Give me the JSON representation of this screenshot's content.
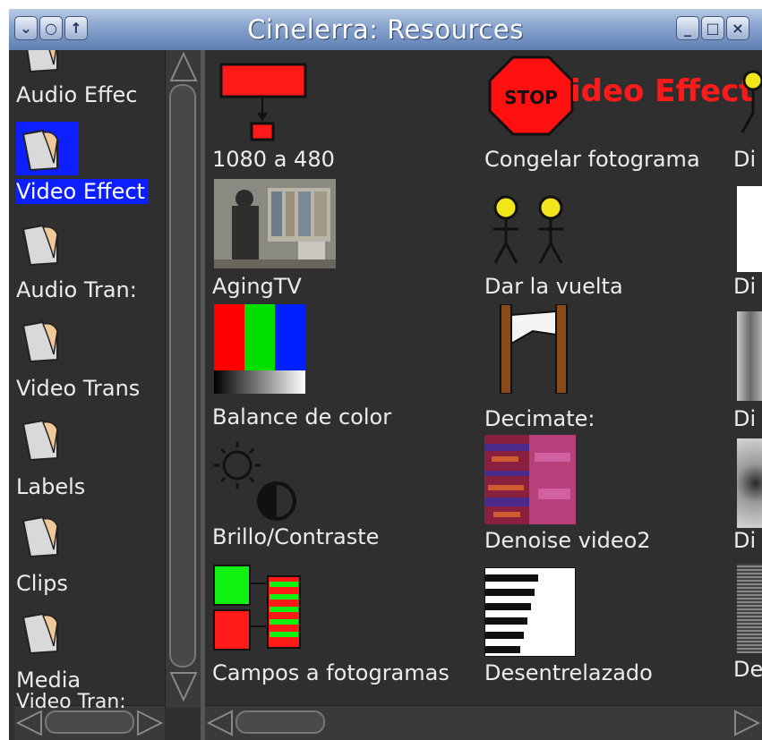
{
  "window": {
    "title": "Cinelerra: Resources",
    "left_buttons": [
      "menu-icon",
      "circle-icon",
      "up-arrow-icon"
    ],
    "right_buttons": [
      "minimize-icon",
      "maximize-icon",
      "close-icon"
    ],
    "right_button_glyphs": [
      "_",
      "□",
      "×"
    ],
    "left_button_glyphs": [
      "⌄",
      "○",
      "↑"
    ]
  },
  "folders": [
    {
      "label": "Audio Effec",
      "selected": false
    },
    {
      "label": "Video Effect",
      "selected": true
    },
    {
      "label": "Audio Tran:",
      "selected": false
    },
    {
      "label": "Video Trans",
      "selected": false
    },
    {
      "label": "Labels",
      "selected": false
    },
    {
      "label": "Clips",
      "selected": false
    },
    {
      "label": "Media",
      "selected": false
    }
  ],
  "bottom_partial_label": "Video Tran:",
  "resources": {
    "col1": [
      "1080 a 480",
      "AgingTV",
      "Balance de color",
      "Brillo/Contraste",
      "Campos a fotogramas"
    ],
    "col2": [
      "Congelar fotograma",
      "Dar la vuelta",
      "Decimate:",
      "Denoise video2",
      "Desentrelazado"
    ],
    "col3": [
      "Di",
      "Di",
      "Di",
      "Di",
      "De"
    ],
    "stop_sign_text": "STOP",
    "overlay_text": "ideo Effect"
  },
  "colors": {
    "selection": "#0d1fff",
    "background": "#2f2f2f",
    "text": "#ececec",
    "titlebar": "#7f9cc8"
  }
}
